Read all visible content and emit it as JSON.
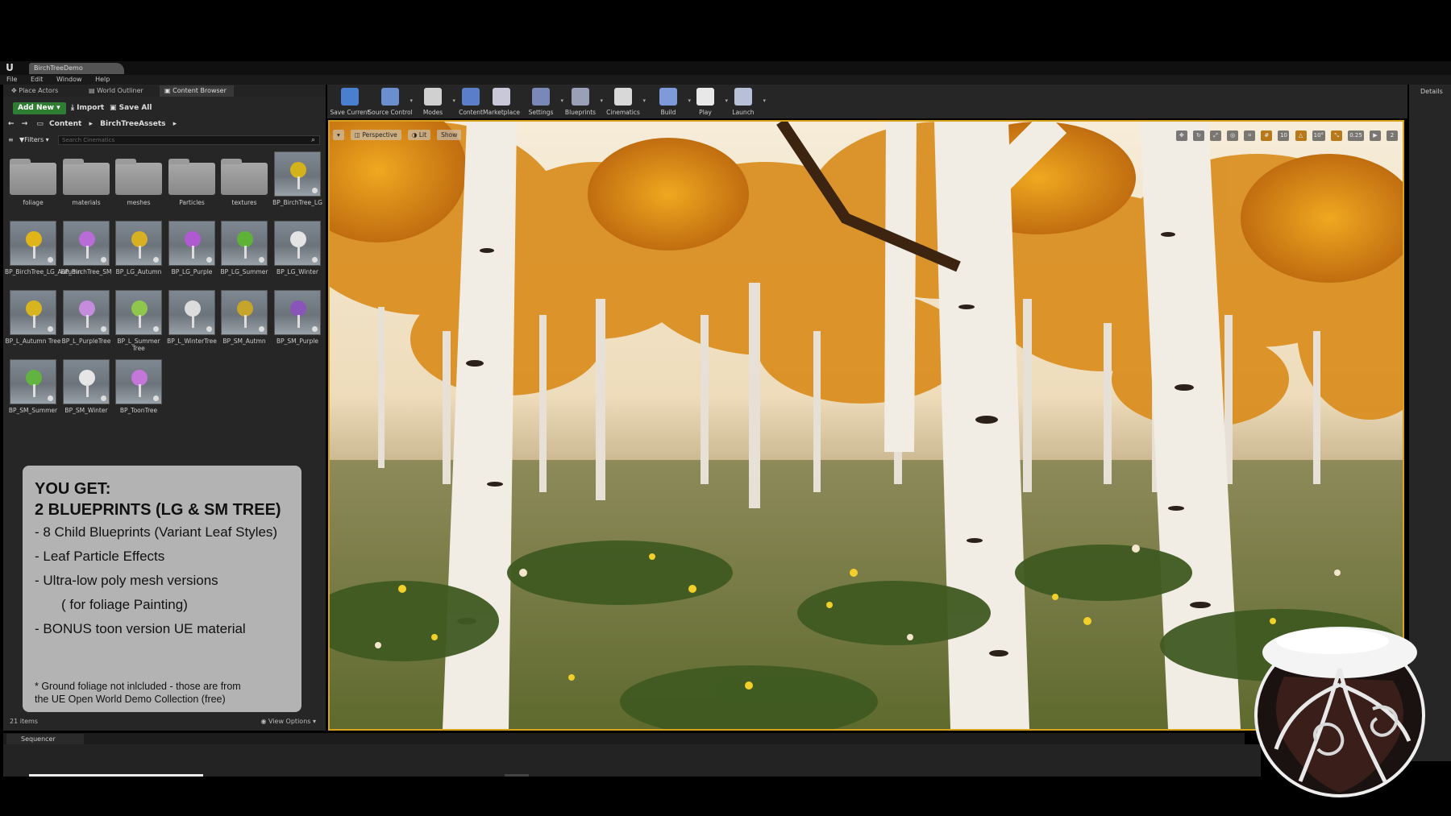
{
  "window": {
    "title": "BirchTreeDemo",
    "logo": "U"
  },
  "menu": [
    "File",
    "Edit",
    "Window",
    "Help"
  ],
  "left_tabs": [
    {
      "label": "Place Actors",
      "icon": "place-actors-icon"
    },
    {
      "label": "World Outliner",
      "icon": "outliner-icon"
    },
    {
      "label": "Content Browser",
      "icon": "content-browser-icon"
    }
  ],
  "content_browser": {
    "add_new": "Add New",
    "import": "Import",
    "save_all": "Save All",
    "breadcrumb": [
      "Content",
      "BirchTreeAssets"
    ],
    "filters": "Filters",
    "search_placeholder": "Search Cinematics",
    "items": [
      {
        "name": "foliage",
        "kind": "folder"
      },
      {
        "name": "materials",
        "kind": "folder"
      },
      {
        "name": "meshes",
        "kind": "folder"
      },
      {
        "name": "Particles",
        "kind": "folder"
      },
      {
        "name": "textures",
        "kind": "folder"
      },
      {
        "name": "BP_BirchTree_LG",
        "kind": "tree",
        "leaf_color": "#d4b21c"
      },
      {
        "name": "BP_BirchTree_LG_Autumn",
        "kind": "tree",
        "leaf_color": "#e0b51a"
      },
      {
        "name": "BP_BirchTree_SM",
        "kind": "tree",
        "leaf_color": "#b86cd6"
      },
      {
        "name": "BP_LG_Autumn",
        "kind": "tree",
        "leaf_color": "#d7b023"
      },
      {
        "name": "BP_LG_Purple",
        "kind": "tree",
        "leaf_color": "#b05ad2"
      },
      {
        "name": "BP_LG_Summer",
        "kind": "tree",
        "leaf_color": "#5fb238"
      },
      {
        "name": "BP_LG_Winter",
        "kind": "tree",
        "leaf_color": "#e4e4e4"
      },
      {
        "name": "BP_L_Autumn Tree",
        "kind": "tree",
        "leaf_color": "#d8b420"
      },
      {
        "name": "BP_L_PurpleTree",
        "kind": "tree",
        "leaf_color": "#c58bdd"
      },
      {
        "name": "BP_L_Summer Tree",
        "kind": "tree",
        "leaf_color": "#8fc64c"
      },
      {
        "name": "BP_L_WinterTree",
        "kind": "tree",
        "leaf_color": "#dcdcdc"
      },
      {
        "name": "BP_SM_Autmn",
        "kind": "tree",
        "leaf_color": "#c7a52a"
      },
      {
        "name": "BP_SM_Purple",
        "kind": "tree",
        "leaf_color": "#8a55b8"
      },
      {
        "name": "BP_SM_Summer",
        "kind": "tree",
        "leaf_color": "#62b340"
      },
      {
        "name": "BP_SM_Winter",
        "kind": "tree",
        "leaf_color": "#e6e6e6"
      },
      {
        "name": "BP_ToonTree",
        "kind": "tree",
        "leaf_color": "#c477d8"
      }
    ],
    "item_count": "21 items",
    "view_options": "View Options"
  },
  "info_box": {
    "heading1": "YOU GET:",
    "heading2": "2 BLUEPRINTS (LG & SM TREE)",
    "lines": [
      "- 8 Child Blueprints (Variant Leaf Styles)",
      "- Leaf Particle Effects",
      "- Ultra-low poly mesh versions",
      "( for foliage Painting)",
      "- BONUS toon version UE material"
    ],
    "note_line1": "* Ground foliage not inlcluded - those are from",
    "note_line2": "the UE Open World Demo Collection (free)"
  },
  "toolbar": [
    {
      "label": "Save Current",
      "icon": "save-icon",
      "color": "#4a7fd0",
      "arrow": false
    },
    {
      "label": "Source Control",
      "icon": "source-control-icon",
      "color": "#6b8ecf",
      "arrow": true
    },
    {
      "label": "Modes",
      "icon": "modes-icon",
      "color": "#d0d0d0",
      "arrow": true
    },
    {
      "label": "Content",
      "icon": "content-icon",
      "color": "#5a7ec8",
      "arrow": false
    },
    {
      "label": "Marketplace",
      "icon": "marketplace-icon",
      "color": "#c8c8d8",
      "arrow": false
    },
    {
      "label": "Settings",
      "icon": "settings-icon",
      "color": "#7a88b8",
      "arrow": true
    },
    {
      "label": "Blueprints",
      "icon": "blueprints-icon",
      "color": "#9aa0b8",
      "arrow": true
    },
    {
      "label": "Cinematics",
      "icon": "cinematics-icon",
      "color": "#d8d8d8",
      "arrow": true
    },
    {
      "label": "Build",
      "icon": "build-icon",
      "color": "#7e9ad8",
      "arrow": true
    },
    {
      "label": "Play",
      "icon": "play-icon",
      "color": "#e8e8e8",
      "arrow": true
    },
    {
      "label": "Launch",
      "icon": "launch-icon",
      "color": "#b8c0d8",
      "arrow": true
    }
  ],
  "viewport": {
    "perspective": "Perspective",
    "lit": "Lit",
    "show": "Show",
    "grid_snap": "10",
    "rot_snap": "10°",
    "scale_snap": "0.25",
    "cam_speed": "2"
  },
  "details_tab": "Details",
  "sequencer_tab": "Sequencer",
  "colors": {
    "accent_border": "#d8a21c",
    "add_new": "#2f7d32",
    "panel": "#262626"
  }
}
